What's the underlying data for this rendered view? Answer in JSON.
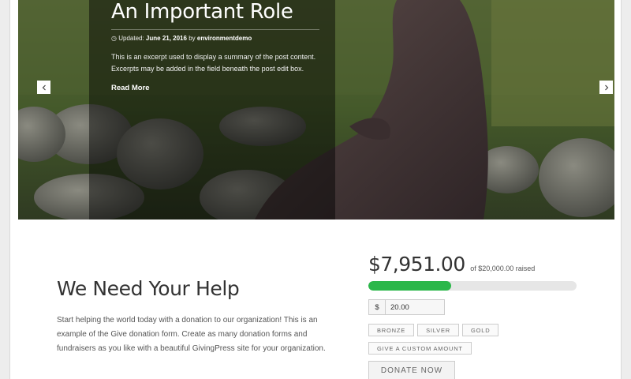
{
  "slider": {
    "title": "An Important Role",
    "meta_prefix": "Updated:",
    "meta_date": "June 21, 2016",
    "meta_by": "by",
    "meta_author": "environmentdemo",
    "excerpt": "This is an excerpt used to display a summary of the post content. Excerpts may be added in the field beneath the post edit box.",
    "read_more": "Read More",
    "prev_icon": "chevron-left-icon",
    "next_icon": "chevron-right-icon"
  },
  "help": {
    "title": "We Need Your Help",
    "text": "Start helping the world today with a donation to our organization! This is an example of the Give donation form. Create as many donation forms and fundraisers as you like with a beautiful GivingPress site for your organization."
  },
  "donation": {
    "raised": "$7,951.00",
    "goal_text": "of $20,000.00 raised",
    "progress_fraction": 0.3976,
    "progress_color": "#2bb74a",
    "currency_symbol": "$",
    "amount_value": "20.00",
    "levels": [
      "BRONZE",
      "SILVER",
      "GOLD"
    ],
    "custom_label": "GIVE A CUSTOM AMOUNT",
    "donate_label": "DONATE NOW"
  }
}
